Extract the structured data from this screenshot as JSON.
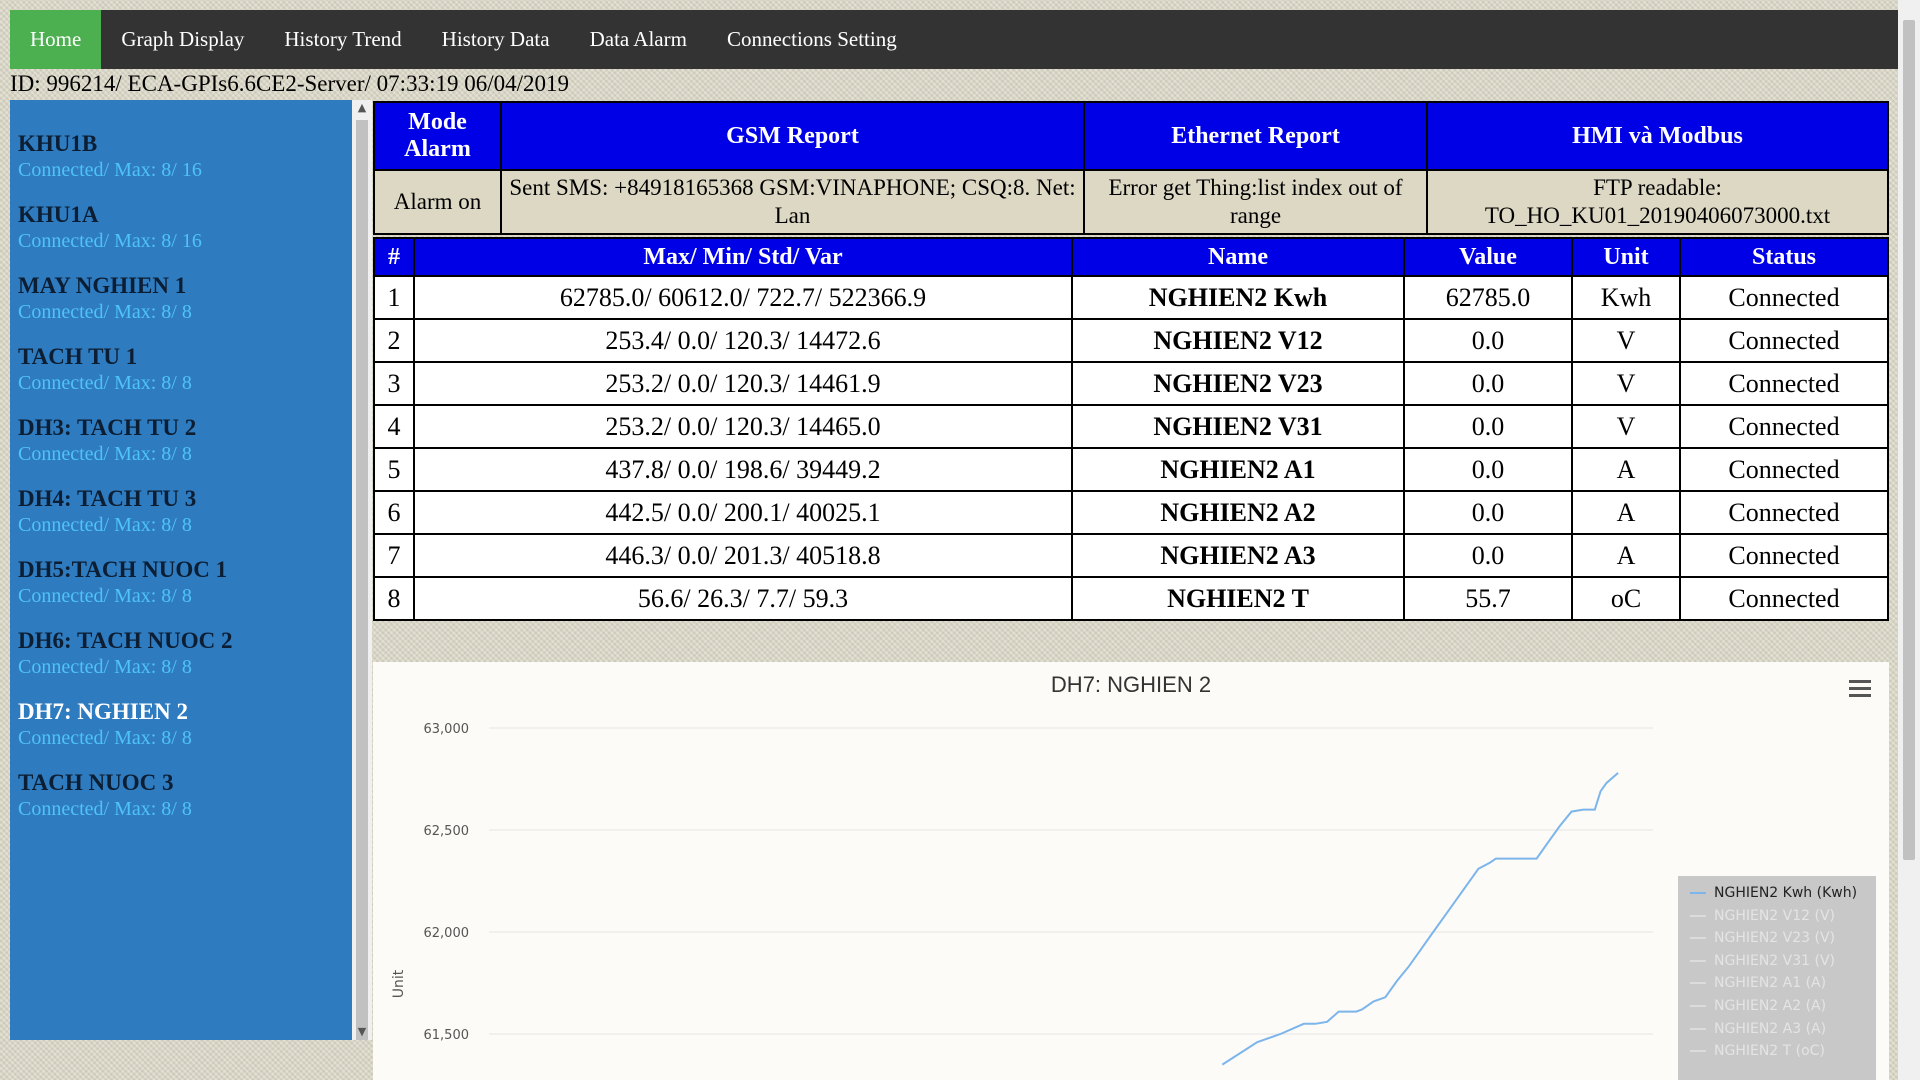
{
  "nav": {
    "items": [
      "Home",
      "Graph Display",
      "History Trend",
      "History Data",
      "Data Alarm",
      "Connections Setting"
    ]
  },
  "header": {
    "id_line": "ID: 996214/ ECA-GPIs6.6CE2-Server/ 07:33:19 06/04/2019"
  },
  "sidebar": {
    "items": [
      {
        "name": "KHU1B",
        "sub": "Connected/ Max: 8/ 16"
      },
      {
        "name": "KHU1A",
        "sub": "Connected/ Max: 8/ 16"
      },
      {
        "name": "MAY NGHIEN 1",
        "sub": "Connected/ Max: 8/ 8"
      },
      {
        "name": "TACH TU 1",
        "sub": "Connected/ Max: 8/ 8"
      },
      {
        "name": "DH3: TACH TU 2",
        "sub": "Connected/ Max: 8/ 8"
      },
      {
        "name": "DH4: TACH TU 3",
        "sub": "Connected/ Max: 8/ 8"
      },
      {
        "name": "DH5:TACH NUOC 1",
        "sub": "Connected/ Max: 8/ 8"
      },
      {
        "name": "DH6: TACH NUOC 2",
        "sub": "Connected/ Max: 8/ 8"
      },
      {
        "name": "DH7: NGHIEN 2",
        "sub": "Connected/ Max: 8/ 8"
      },
      {
        "name": "TACH NUOC 3",
        "sub": "Connected/ Max: 8/ 8"
      }
    ]
  },
  "report": {
    "headers": [
      "Mode Alarm",
      "GSM Report",
      "Ethernet Report",
      "HMI và Modbus"
    ],
    "values": [
      "Alarm on",
      "Sent SMS: +84918165368 GSM:VINAPHONE; CSQ:8. Net: Lan",
      "Error get Thing:list index out of range",
      "FTP readable: TO_HO_KU01_20190406073000.txt"
    ]
  },
  "table": {
    "headers": [
      "#",
      "Max/ Min/ Std/ Var",
      "Name",
      "Value",
      "Unit",
      "Status"
    ],
    "rows": [
      {
        "n": "1",
        "stats": "62785.0/ 60612.0/ 722.7/ 522366.9",
        "name": "NGHIEN2 Kwh",
        "value": "62785.0",
        "unit": "Kwh",
        "status": "Connected"
      },
      {
        "n": "2",
        "stats": "253.4/ 0.0/ 120.3/ 14472.6",
        "name": "NGHIEN2 V12",
        "value": "0.0",
        "unit": "V",
        "status": "Connected"
      },
      {
        "n": "3",
        "stats": "253.2/ 0.0/ 120.3/ 14461.9",
        "name": "NGHIEN2 V23",
        "value": "0.0",
        "unit": "V",
        "status": "Connected"
      },
      {
        "n": "4",
        "stats": "253.2/ 0.0/ 120.3/ 14465.0",
        "name": "NGHIEN2 V31",
        "value": "0.0",
        "unit": "V",
        "status": "Connected"
      },
      {
        "n": "5",
        "stats": "437.8/ 0.0/ 198.6/ 39449.2",
        "name": "NGHIEN2 A1",
        "value": "0.0",
        "unit": "A",
        "status": "Connected"
      },
      {
        "n": "6",
        "stats": "442.5/ 0.0/ 200.1/ 40025.1",
        "name": "NGHIEN2 A2",
        "value": "0.0",
        "unit": "A",
        "status": "Connected"
      },
      {
        "n": "7",
        "stats": "446.3/ 0.0/ 201.3/ 40518.8",
        "name": "NGHIEN2 A3",
        "value": "0.0",
        "unit": "A",
        "status": "Connected"
      },
      {
        "n": "8",
        "stats": "56.6/ 26.3/ 7.7/ 59.3",
        "name": "NGHIEN2 T",
        "value": "55.7",
        "unit": "oC",
        "status": "Connected"
      }
    ]
  },
  "chart": {
    "title": "DH7: NGHIEN 2",
    "menu_icon": "hamburger-menu-icon"
  },
  "chart_data": {
    "type": "line",
    "title": "DH7: NGHIEN 2",
    "ylabel": "Unit",
    "xlabel": "",
    "yticks": [
      "63,000",
      "62,500",
      "62,000",
      "61,500"
    ],
    "ylim": [
      61500,
      63000
    ],
    "legend_placement": "right",
    "legend": [
      "NGHIEN2 Kwh (Kwh)",
      "NGHIEN2 V12 (V)",
      "NGHIEN2 V23 (V)",
      "NGHIEN2 V31 (V)",
      "NGHIEN2 A1 (A)",
      "NGHIEN2 A2 (A)",
      "NGHIEN2 A3 (A)",
      "NGHIEN2 T (oC)"
    ],
    "active_series": 0,
    "grid": true,
    "series": [
      {
        "name": "NGHIEN2 Kwh (Kwh)",
        "color": "#7cb5ec",
        "x": [
          0.63,
          0.66,
          0.68,
          0.7,
          0.71,
          0.72,
          0.73,
          0.74,
          0.745,
          0.75,
          0.76,
          0.77,
          0.78,
          0.79,
          0.8,
          0.81,
          0.82,
          0.83,
          0.84,
          0.85,
          0.86,
          0.865,
          0.87,
          0.88,
          0.89,
          0.9,
          0.91,
          0.92,
          0.93,
          0.94,
          0.945,
          0.95,
          0.955,
          0.96,
          0.97
        ],
        "y": [
          61350,
          61460,
          61500,
          61550,
          61550,
          61560,
          61610,
          61610,
          61610,
          61620,
          61660,
          61680,
          61760,
          61830,
          61910,
          61990,
          62070,
          62150,
          62230,
          62310,
          62340,
          62360,
          62360,
          62360,
          62360,
          62360,
          62440,
          62520,
          62590,
          62600,
          62600,
          62600,
          62690,
          62730,
          62780
        ]
      }
    ]
  }
}
